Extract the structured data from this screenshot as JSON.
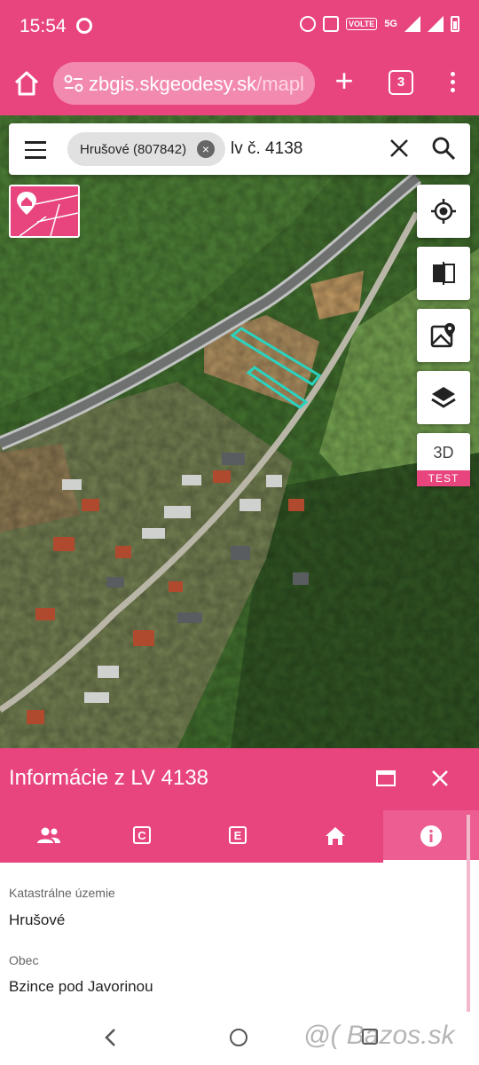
{
  "status_bar": {
    "time": "15:54",
    "network_label": "5G",
    "volte_label": "VOLTE"
  },
  "browser": {
    "url_main": "zbgis.skgeodesy.sk",
    "url_path": "/mapl",
    "tab_count": "3"
  },
  "search": {
    "chip_label": "Hrušové (807842)",
    "query": "lv č. 4138"
  },
  "map_controls": {
    "threed_label": "3D",
    "threed_badge": "TEST"
  },
  "panel": {
    "title": "Informácie z LV 4138",
    "tabs": [
      {
        "name": "owners",
        "letter": ""
      },
      {
        "name": "c-register",
        "letter": "C"
      },
      {
        "name": "e-register",
        "letter": "E"
      },
      {
        "name": "buildings",
        "letter": ""
      },
      {
        "name": "info",
        "letter": ""
      }
    ],
    "fields": [
      {
        "label": "Katastrálne územie",
        "value": "Hrušové"
      },
      {
        "label": "Obec",
        "value": "Bzince pod Javorinou"
      }
    ]
  },
  "watermark": "@( Bazos.sk",
  "colors": {
    "accent": "#e8457f",
    "parcel_highlight": "#2ad3c0"
  }
}
